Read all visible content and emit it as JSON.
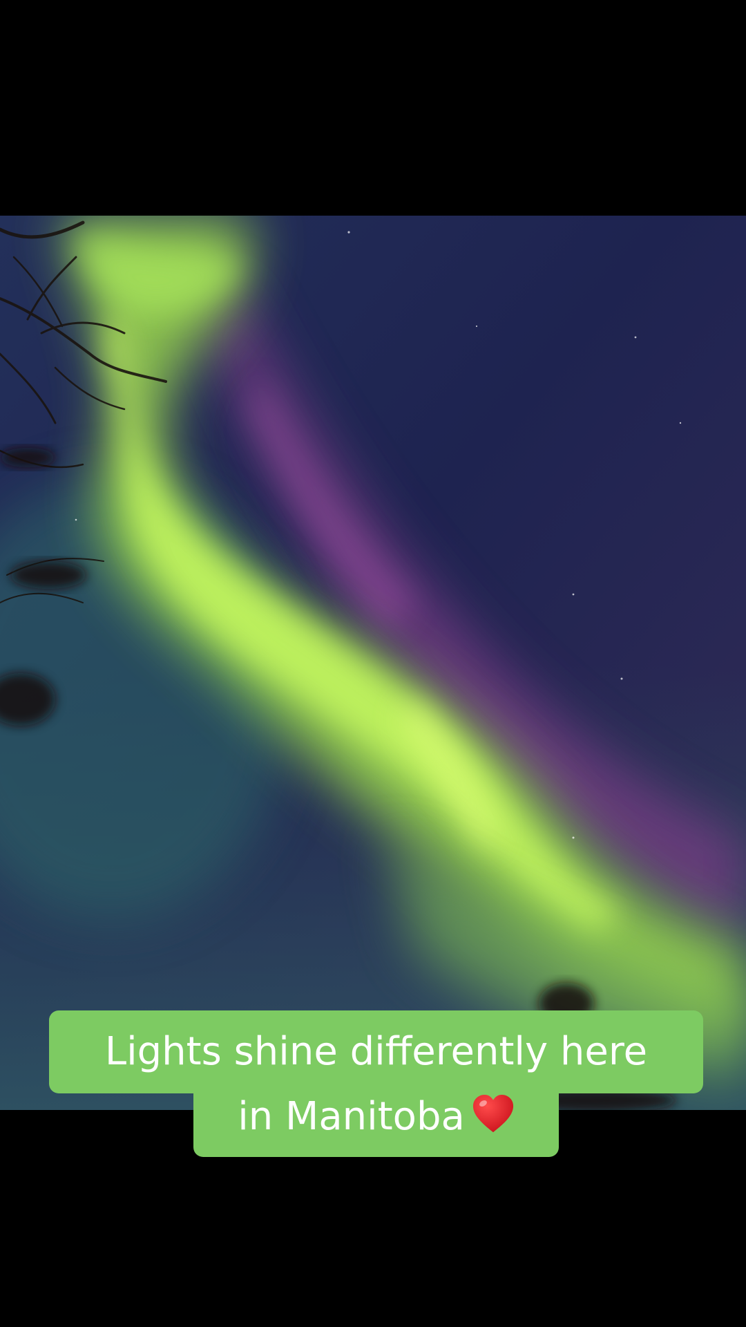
{
  "caption": {
    "line1": "Lights shine differently here",
    "line2": "in Manitoba",
    "emoji": "red-heart"
  },
  "colors": {
    "caption_background": "#7dcb62",
    "caption_text": "#ffffff",
    "letterbox": "#000000",
    "sky": "#1f2350",
    "aurora_green": "#b6f25a",
    "aurora_purple": "#7a3d86"
  }
}
